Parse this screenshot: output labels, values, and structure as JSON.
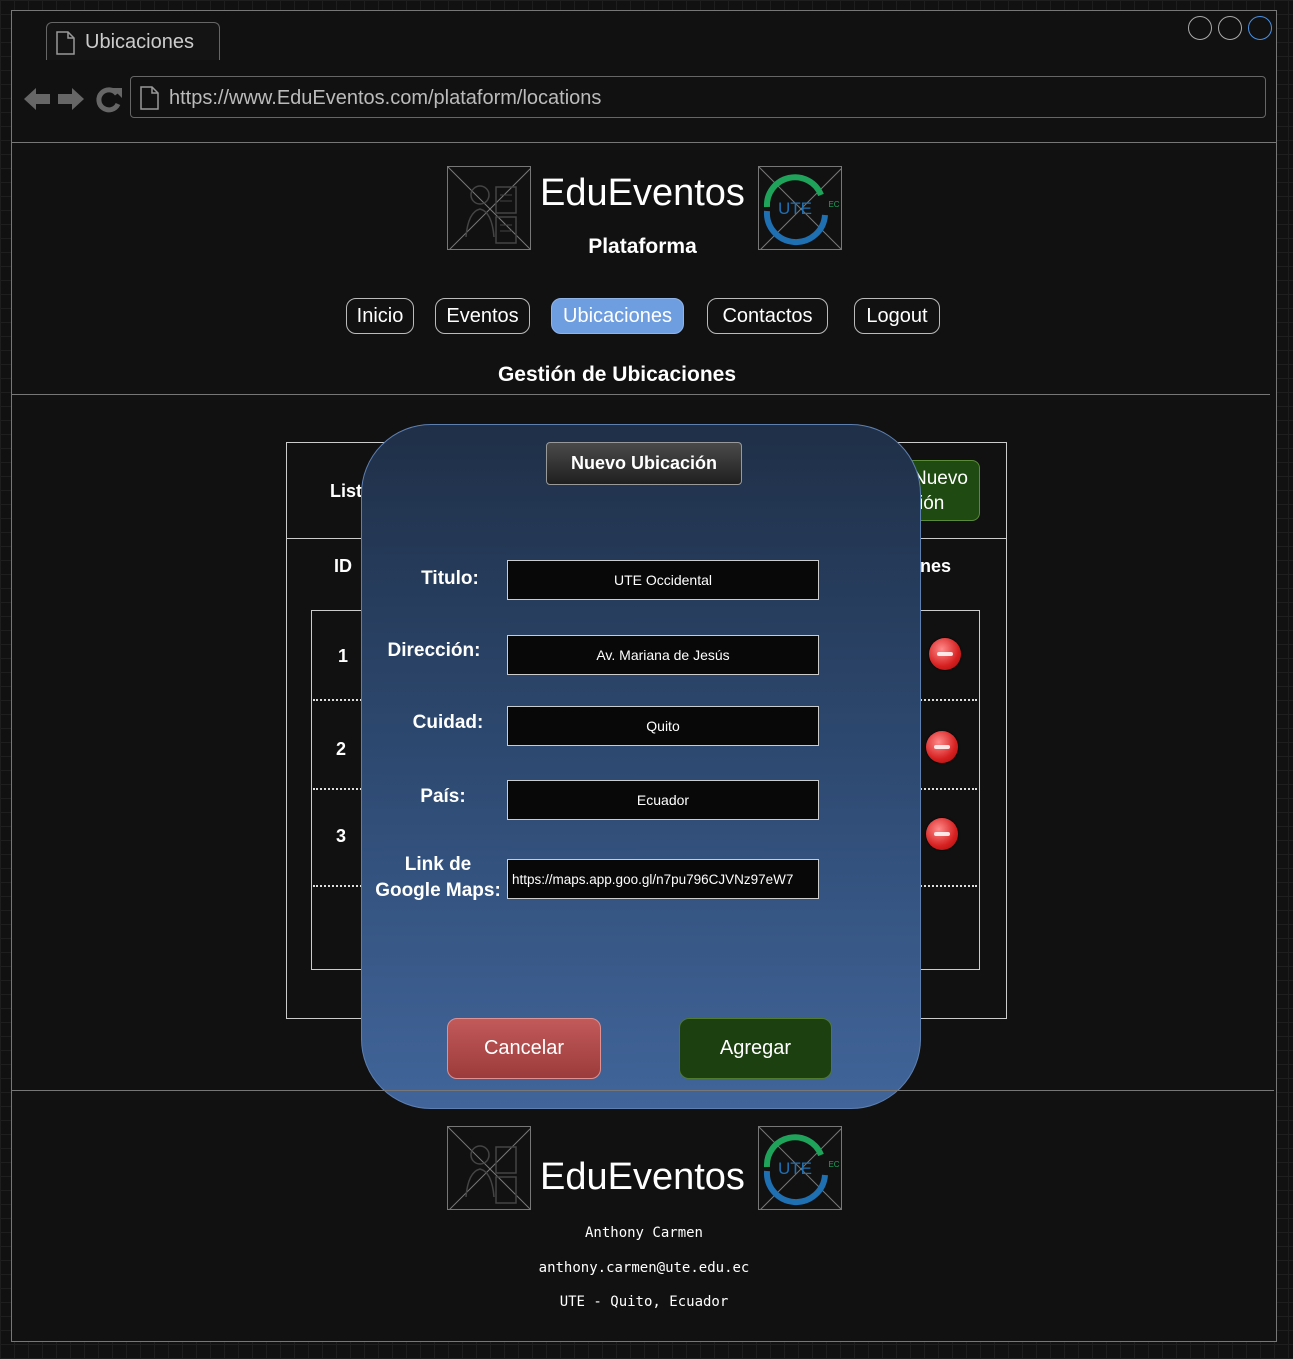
{
  "browser": {
    "tab_title": "Ubicaciones",
    "url": "https://www.EduEventos.com/plataform/locations"
  },
  "header": {
    "brand": "EduEventos",
    "subtitle": "Plataforma"
  },
  "nav": {
    "items": [
      {
        "label": "Inicio"
      },
      {
        "label": "Eventos"
      },
      {
        "label": "Ubicaciones",
        "active": true
      },
      {
        "label": "Contactos"
      },
      {
        "label": "Logout"
      }
    ]
  },
  "page_title": "Gestión de Ubicaciones",
  "panel": {
    "list_title_partial": "List",
    "new_button_partial_line1": "Nuevo",
    "new_button_partial_line2": "ión",
    "col_id": "ID",
    "col_actions_partial": "nes",
    "rows": [
      {
        "id": "1"
      },
      {
        "id": "2"
      },
      {
        "id": "3"
      }
    ]
  },
  "modal": {
    "title": "Nuevo Ubicación",
    "fields": [
      {
        "label": "Titulo:",
        "value": "UTE Occidental"
      },
      {
        "label": "Dirección:",
        "value": "Av. Mariana de Jesús"
      },
      {
        "label": "Cuidad:",
        "value": "Quito"
      },
      {
        "label": "País:",
        "value": "Ecuador"
      },
      {
        "label_line1": "Link de",
        "label_line2": "Google Maps:",
        "value": "https://maps.app.goo.gl/n7pu796CJVNz97eW7"
      }
    ],
    "cancel_label": "Cancelar",
    "add_label": "Agregar"
  },
  "footer": {
    "brand": "EduEventos",
    "author": "Anthony Carmen",
    "email": "anthony.carmen@ute.edu.ec",
    "location": "UTE - Quito, Ecuador"
  },
  "colors": {
    "nav_active": "#6f9ee0",
    "cancel": "#b04a4a",
    "add": "#1d4010",
    "modal_top": "#1f2f47",
    "modal_bottom": "#41659a",
    "delete_icon": "#d62020"
  }
}
